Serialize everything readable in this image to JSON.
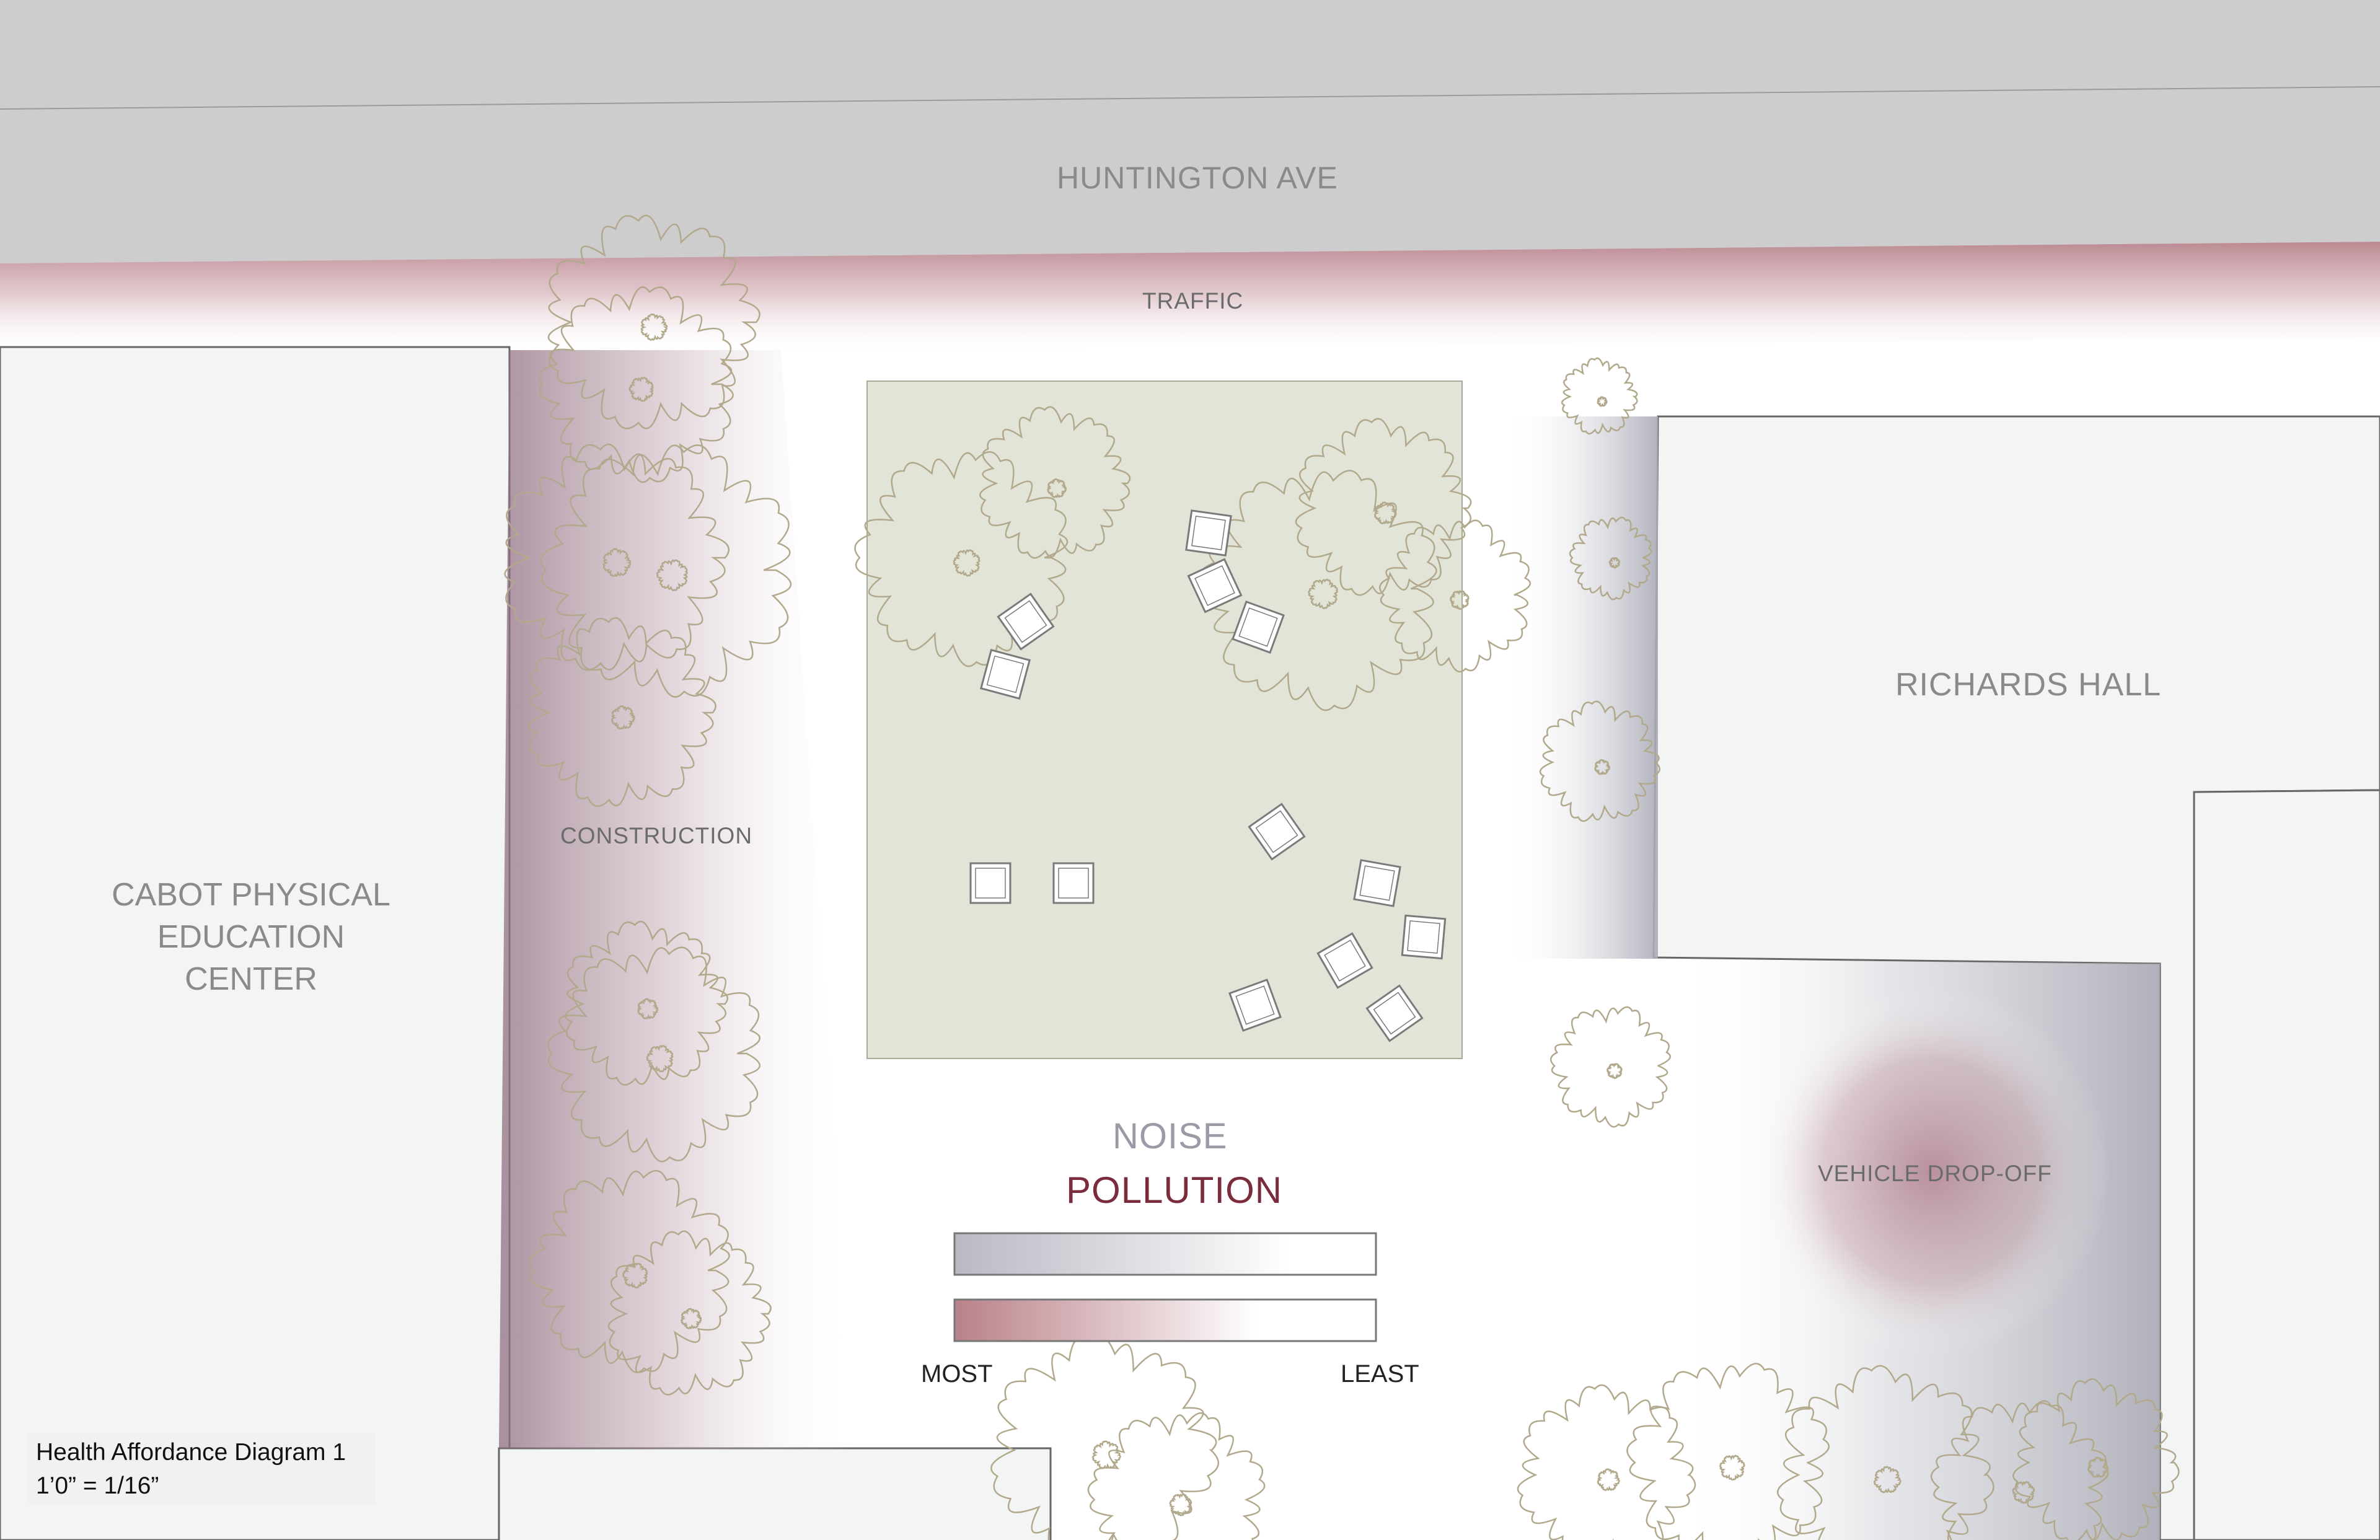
{
  "title": "Health Affordance Diagram 1",
  "scale": "1’0” = 1/16”",
  "labels": {
    "street": "HUNTINGTON AVE",
    "traffic": "TRAFFIC",
    "construction": "CONSTRUCTION",
    "building_left": "CABOT PHYSICAL EDUCATION CENTER",
    "building_right": "RICHARDS HALL",
    "dropoff": "VEHICLE DROP-OFF"
  },
  "legend": {
    "noise": "NOISE",
    "pollution": "POLLUTION",
    "most": "MOST",
    "least": "LEAST"
  },
  "colors": {
    "road": "#cdcdcd",
    "building": "#f3f5f4",
    "plaza": "#e1e4d7",
    "pollution": "#b9858e",
    "noise": "#b3b4bd",
    "tree_outline": "#b2a88c",
    "pollution_text": "#7b2c3c",
    "noise_text": "#9a9ba6"
  }
}
